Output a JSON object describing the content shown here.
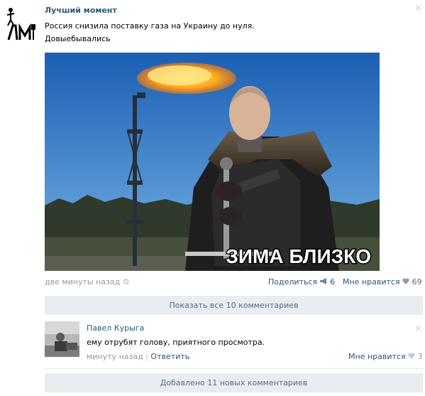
{
  "post": {
    "author": "Лучший момент",
    "text_line1": "Россия снизила поставку газа на Украину до нуля.",
    "text_line2": "Довыебывались",
    "image_caption": "ЗИМА БЛИЗКО",
    "time": "две минуты назад",
    "share_label": "Поделиться",
    "share_count": "6",
    "like_label": "Мне нравится",
    "like_count": "69"
  },
  "show_comments": "Показать все 10 комментариев",
  "comment": {
    "author": "Павел Курыга",
    "text": "ему отрубят голову, приятного просмотра.",
    "time": "минуту назад",
    "separator": "|",
    "reply_label": "Ответить",
    "like_label": "Мне нравится",
    "like_count": "3"
  },
  "new_comments": "Добавлено 11 новых комментариев",
  "icons": {
    "close": "×",
    "share": "megaphone-icon",
    "like": "heart-icon",
    "settings": "gear-icon"
  },
  "colors": {
    "link": "#2b587a",
    "meta": "#999999",
    "bar_bg": "#e9edf1"
  }
}
